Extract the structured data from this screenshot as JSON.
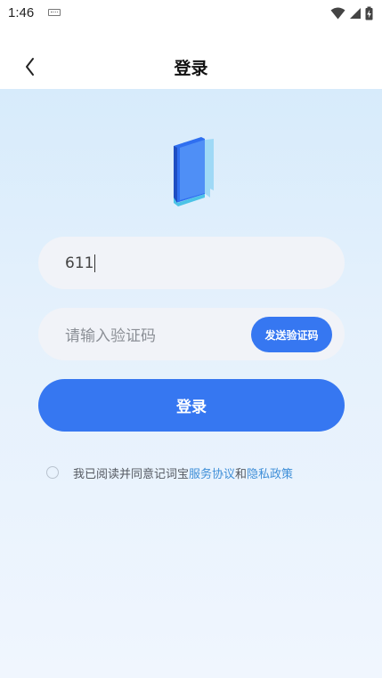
{
  "status_bar": {
    "time": "1:46"
  },
  "header": {
    "title": "登录"
  },
  "form": {
    "phone_value": "611",
    "code_placeholder": "请输入验证码",
    "send_code_label": "发送验证码",
    "login_label": "登录"
  },
  "agreement": {
    "text": "我已阅读并同意记词宝",
    "terms_link": "服务协议",
    "and": "和",
    "privacy_link": "隐私政策",
    "checked": false
  },
  "colors": {
    "primary": "#3677f1",
    "link": "#3f8fd8",
    "background_top": "#d7ebfb",
    "input_bg": "#f1f3f8"
  }
}
